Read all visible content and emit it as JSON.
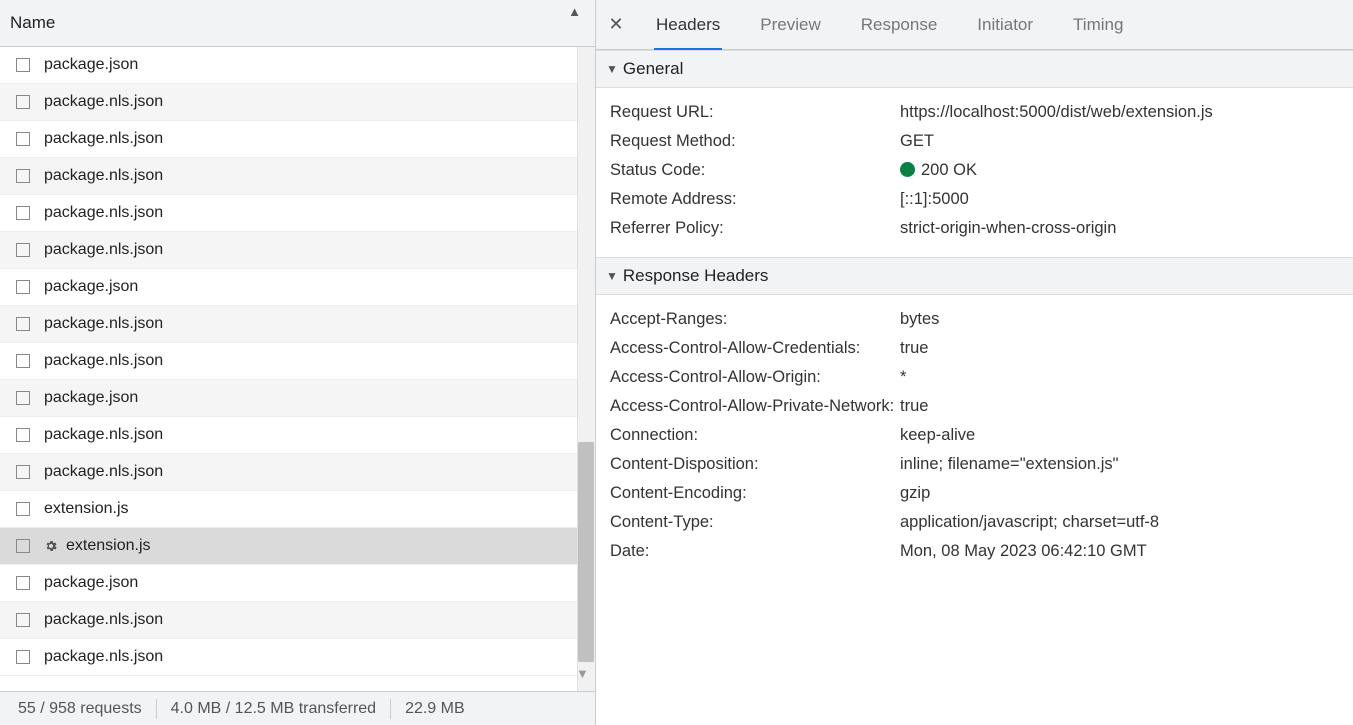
{
  "left": {
    "header": "Name",
    "requests": [
      {
        "name": "package.json",
        "selected": false,
        "gear": false
      },
      {
        "name": "package.nls.json",
        "selected": false,
        "gear": false
      },
      {
        "name": "package.nls.json",
        "selected": false,
        "gear": false
      },
      {
        "name": "package.nls.json",
        "selected": false,
        "gear": false
      },
      {
        "name": "package.nls.json",
        "selected": false,
        "gear": false
      },
      {
        "name": "package.nls.json",
        "selected": false,
        "gear": false
      },
      {
        "name": "package.json",
        "selected": false,
        "gear": false
      },
      {
        "name": "package.nls.json",
        "selected": false,
        "gear": false
      },
      {
        "name": "package.nls.json",
        "selected": false,
        "gear": false
      },
      {
        "name": "package.json",
        "selected": false,
        "gear": false
      },
      {
        "name": "package.nls.json",
        "selected": false,
        "gear": false
      },
      {
        "name": "package.nls.json",
        "selected": false,
        "gear": false
      },
      {
        "name": "extension.js",
        "selected": false,
        "gear": false
      },
      {
        "name": "extension.js",
        "selected": true,
        "gear": true
      },
      {
        "name": "package.json",
        "selected": false,
        "gear": false
      },
      {
        "name": "package.nls.json",
        "selected": false,
        "gear": false
      },
      {
        "name": "package.nls.json",
        "selected": false,
        "gear": false
      }
    ],
    "status": {
      "requests": "55 / 958 requests",
      "transferred": "4.0 MB / 12.5 MB transferred",
      "resources": "22.9 MB"
    }
  },
  "right": {
    "tabs": [
      "Headers",
      "Preview",
      "Response",
      "Initiator",
      "Timing"
    ],
    "activeTab": 0,
    "sections": {
      "general": {
        "title": "General",
        "items": [
          {
            "k": "Request URL:",
            "v": "https://localhost:5000/dist/web/extension.js"
          },
          {
            "k": "Request Method:",
            "v": "GET"
          },
          {
            "k": "Status Code:",
            "v": "200 OK",
            "statusDot": true
          },
          {
            "k": "Remote Address:",
            "v": "[::1]:5000"
          },
          {
            "k": "Referrer Policy:",
            "v": "strict-origin-when-cross-origin"
          }
        ]
      },
      "responseHeaders": {
        "title": "Response Headers",
        "items": [
          {
            "k": "Accept-Ranges:",
            "v": "bytes"
          },
          {
            "k": "Access-Control-Allow-Credentials:",
            "v": "true"
          },
          {
            "k": "Access-Control-Allow-Origin:",
            "v": "*"
          },
          {
            "k": "Access-Control-Allow-Private-Network:",
            "v": "true"
          },
          {
            "k": "Connection:",
            "v": "keep-alive"
          },
          {
            "k": "Content-Disposition:",
            "v": "inline; filename=\"extension.js\""
          },
          {
            "k": "Content-Encoding:",
            "v": "gzip"
          },
          {
            "k": "Content-Type:",
            "v": "application/javascript; charset=utf-8"
          },
          {
            "k": "Date:",
            "v": "Mon, 08 May 2023 06:42:10 GMT"
          }
        ]
      }
    }
  }
}
